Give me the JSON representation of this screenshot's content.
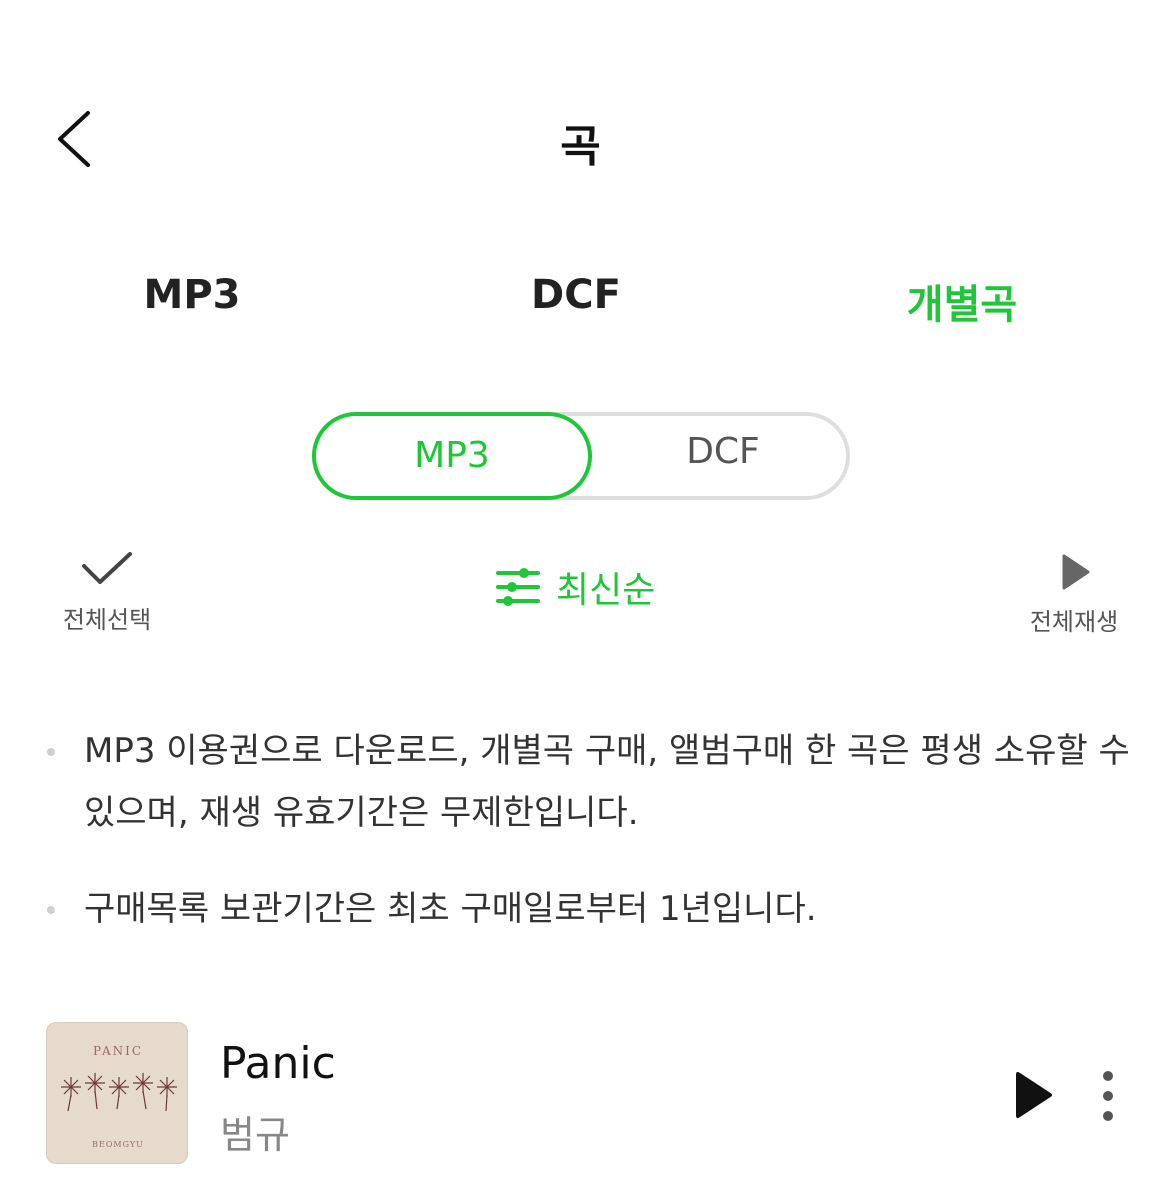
{
  "header": {
    "title": "곡"
  },
  "tabs": [
    {
      "label": "MP3",
      "active": false
    },
    {
      "label": "DCF",
      "active": false
    },
    {
      "label": "개별곡",
      "active": true
    }
  ],
  "segment": {
    "options": [
      "MP3",
      "DCF"
    ],
    "selected": "MP3"
  },
  "actions": {
    "select_all_label": "전체선택",
    "sort_label": "최신순",
    "play_all_label": "전체재생"
  },
  "notices": [
    "MP3 이용권으로 다운로드, 개별곡 구매, 앨범구매 한 곡은 평생 소유할 수 있으며, 재생 유효기간은 무제한입니다.",
    "구매목록 보관기간은 최초 구매일로부터 1년입니다."
  ],
  "songs": [
    {
      "title": "Panic",
      "artist": "범규",
      "album_art_text": "PANIC",
      "album_art_subtext": "BEOMGYU"
    }
  ],
  "colors": {
    "accent": "#1fc738",
    "inactive_tab": "#222222",
    "border": "#dedede",
    "secondary_text": "#888888"
  },
  "icons": {
    "back": "chevron-left-icon",
    "select_all": "check-icon",
    "sort": "sliders-icon",
    "play_all": "play-icon",
    "more": "more-vertical-icon"
  }
}
